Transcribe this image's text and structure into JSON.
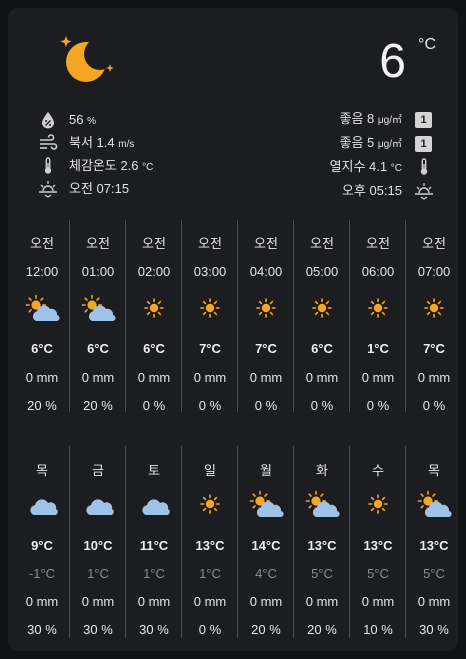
{
  "current": {
    "condition_icon": "moon-stars-icon",
    "temperature": "6",
    "unit": "°C"
  },
  "details_left": [
    {
      "icon": "humidity-icon",
      "value": "56",
      "unit": "%"
    },
    {
      "icon": "wind-icon",
      "value": "북서 1.4",
      "unit": "m/s"
    },
    {
      "icon": "thermometer-icon",
      "value": "체감온도 2.6",
      "unit": "°C"
    },
    {
      "icon": "sunrise-icon",
      "value": "오전 07:15",
      "unit": ""
    }
  ],
  "details_right": [
    {
      "value": "좋음 8",
      "unit": "μg/㎥",
      "badge": "1"
    },
    {
      "value": "좋음 5",
      "unit": "μg/㎥",
      "badge": "1"
    },
    {
      "value": "열지수 4.1",
      "unit": "°C",
      "icon": "thermometer-icon"
    },
    {
      "value": "오후 05:15",
      "unit": "",
      "icon": "sunset-icon"
    }
  ],
  "hourly": [
    {
      "ampm": "오전",
      "time": "12:00",
      "icon": "partly-cloudy-icon",
      "temp": "6°C",
      "precip": "0 mm",
      "prob": "20 %"
    },
    {
      "ampm": "오전",
      "time": "01:00",
      "icon": "partly-cloudy-icon",
      "temp": "6°C",
      "precip": "0 mm",
      "prob": "20 %"
    },
    {
      "ampm": "오전",
      "time": "02:00",
      "icon": "sunny-icon",
      "temp": "6°C",
      "precip": "0 mm",
      "prob": "0 %"
    },
    {
      "ampm": "오전",
      "time": "03:00",
      "icon": "sunny-icon",
      "temp": "7°C",
      "precip": "0 mm",
      "prob": "0 %"
    },
    {
      "ampm": "오전",
      "time": "04:00",
      "icon": "sunny-icon",
      "temp": "7°C",
      "precip": "0 mm",
      "prob": "0 %"
    },
    {
      "ampm": "오전",
      "time": "05:00",
      "icon": "sunny-icon",
      "temp": "6°C",
      "precip": "0 mm",
      "prob": "0 %"
    },
    {
      "ampm": "오전",
      "time": "06:00",
      "icon": "sunny-icon",
      "temp": "1°C",
      "precip": "0 mm",
      "prob": "0 %"
    },
    {
      "ampm": "오전",
      "time": "07:00",
      "icon": "sunny-icon",
      "temp": "7°C",
      "precip": "0 mm",
      "prob": "0 %"
    }
  ],
  "daily": [
    {
      "day": "목",
      "icon": "cloudy-night-icon",
      "high": "9°C",
      "low": "-1°C",
      "precip": "0 mm",
      "prob": "30 %"
    },
    {
      "day": "금",
      "icon": "cloudy-night-icon",
      "high": "10°C",
      "low": "1°C",
      "precip": "0 mm",
      "prob": "30 %"
    },
    {
      "day": "토",
      "icon": "cloudy-night-icon",
      "high": "11°C",
      "low": "1°C",
      "precip": "0 mm",
      "prob": "30 %"
    },
    {
      "day": "일",
      "icon": "sunny-icon",
      "high": "13°C",
      "low": "1°C",
      "precip": "0 mm",
      "prob": "0 %"
    },
    {
      "day": "월",
      "icon": "partly-cloudy-icon",
      "high": "14°C",
      "low": "4°C",
      "precip": "0 mm",
      "prob": "20 %"
    },
    {
      "day": "화",
      "icon": "partly-cloudy-icon",
      "high": "13°C",
      "low": "5°C",
      "precip": "0 mm",
      "prob": "20 %"
    },
    {
      "day": "수",
      "icon": "sunny-icon",
      "high": "13°C",
      "low": "5°C",
      "precip": "0 mm",
      "prob": "10 %"
    },
    {
      "day": "목",
      "icon": "partly-cloudy-icon",
      "high": "13°C",
      "low": "5°C",
      "precip": "0 mm",
      "prob": "30 %"
    }
  ],
  "colors": {
    "sun": "#f5a623",
    "cloud": "#9ec2e8",
    "moon": "#f5a623"
  }
}
